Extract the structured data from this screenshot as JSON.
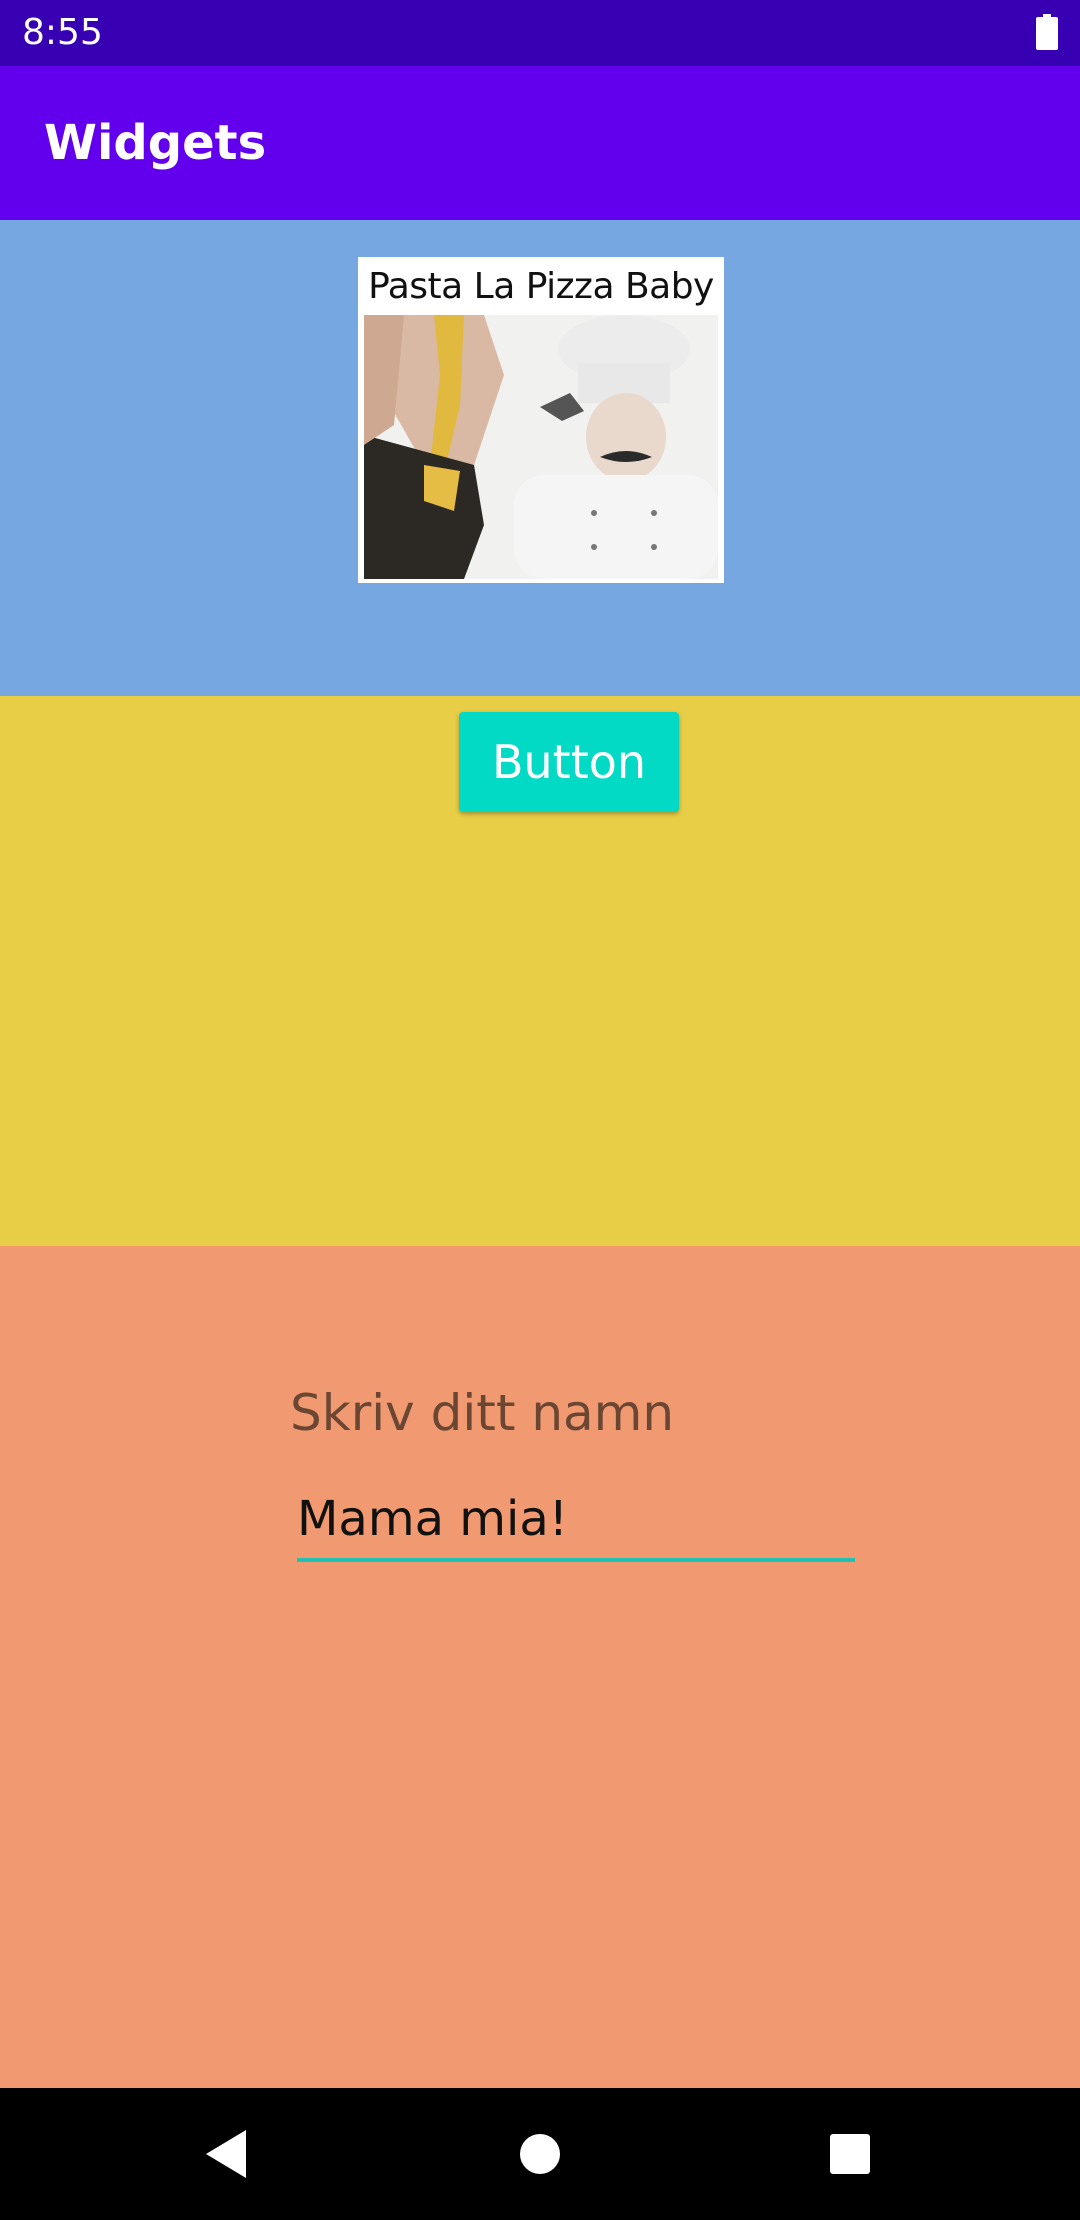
{
  "status_bar": {
    "time": "8:55"
  },
  "app_bar": {
    "title": "Widgets"
  },
  "image": {
    "caption": "Pasta La Pizza Baby"
  },
  "button": {
    "label": "Button"
  },
  "name_field": {
    "label": "Skriv ditt namn",
    "value": "Mama mia!"
  },
  "colors": {
    "status_bar": "#3700b3",
    "app_bar": "#6200ee",
    "section_blue": "#76a7e0",
    "section_yellow": "#e8ce46",
    "section_orange": "#f19a72",
    "accent": "#03dac5"
  },
  "icons": {
    "battery": "battery-icon",
    "back": "back-triangle-icon",
    "home": "home-circle-icon",
    "recents": "recents-square-icon"
  }
}
